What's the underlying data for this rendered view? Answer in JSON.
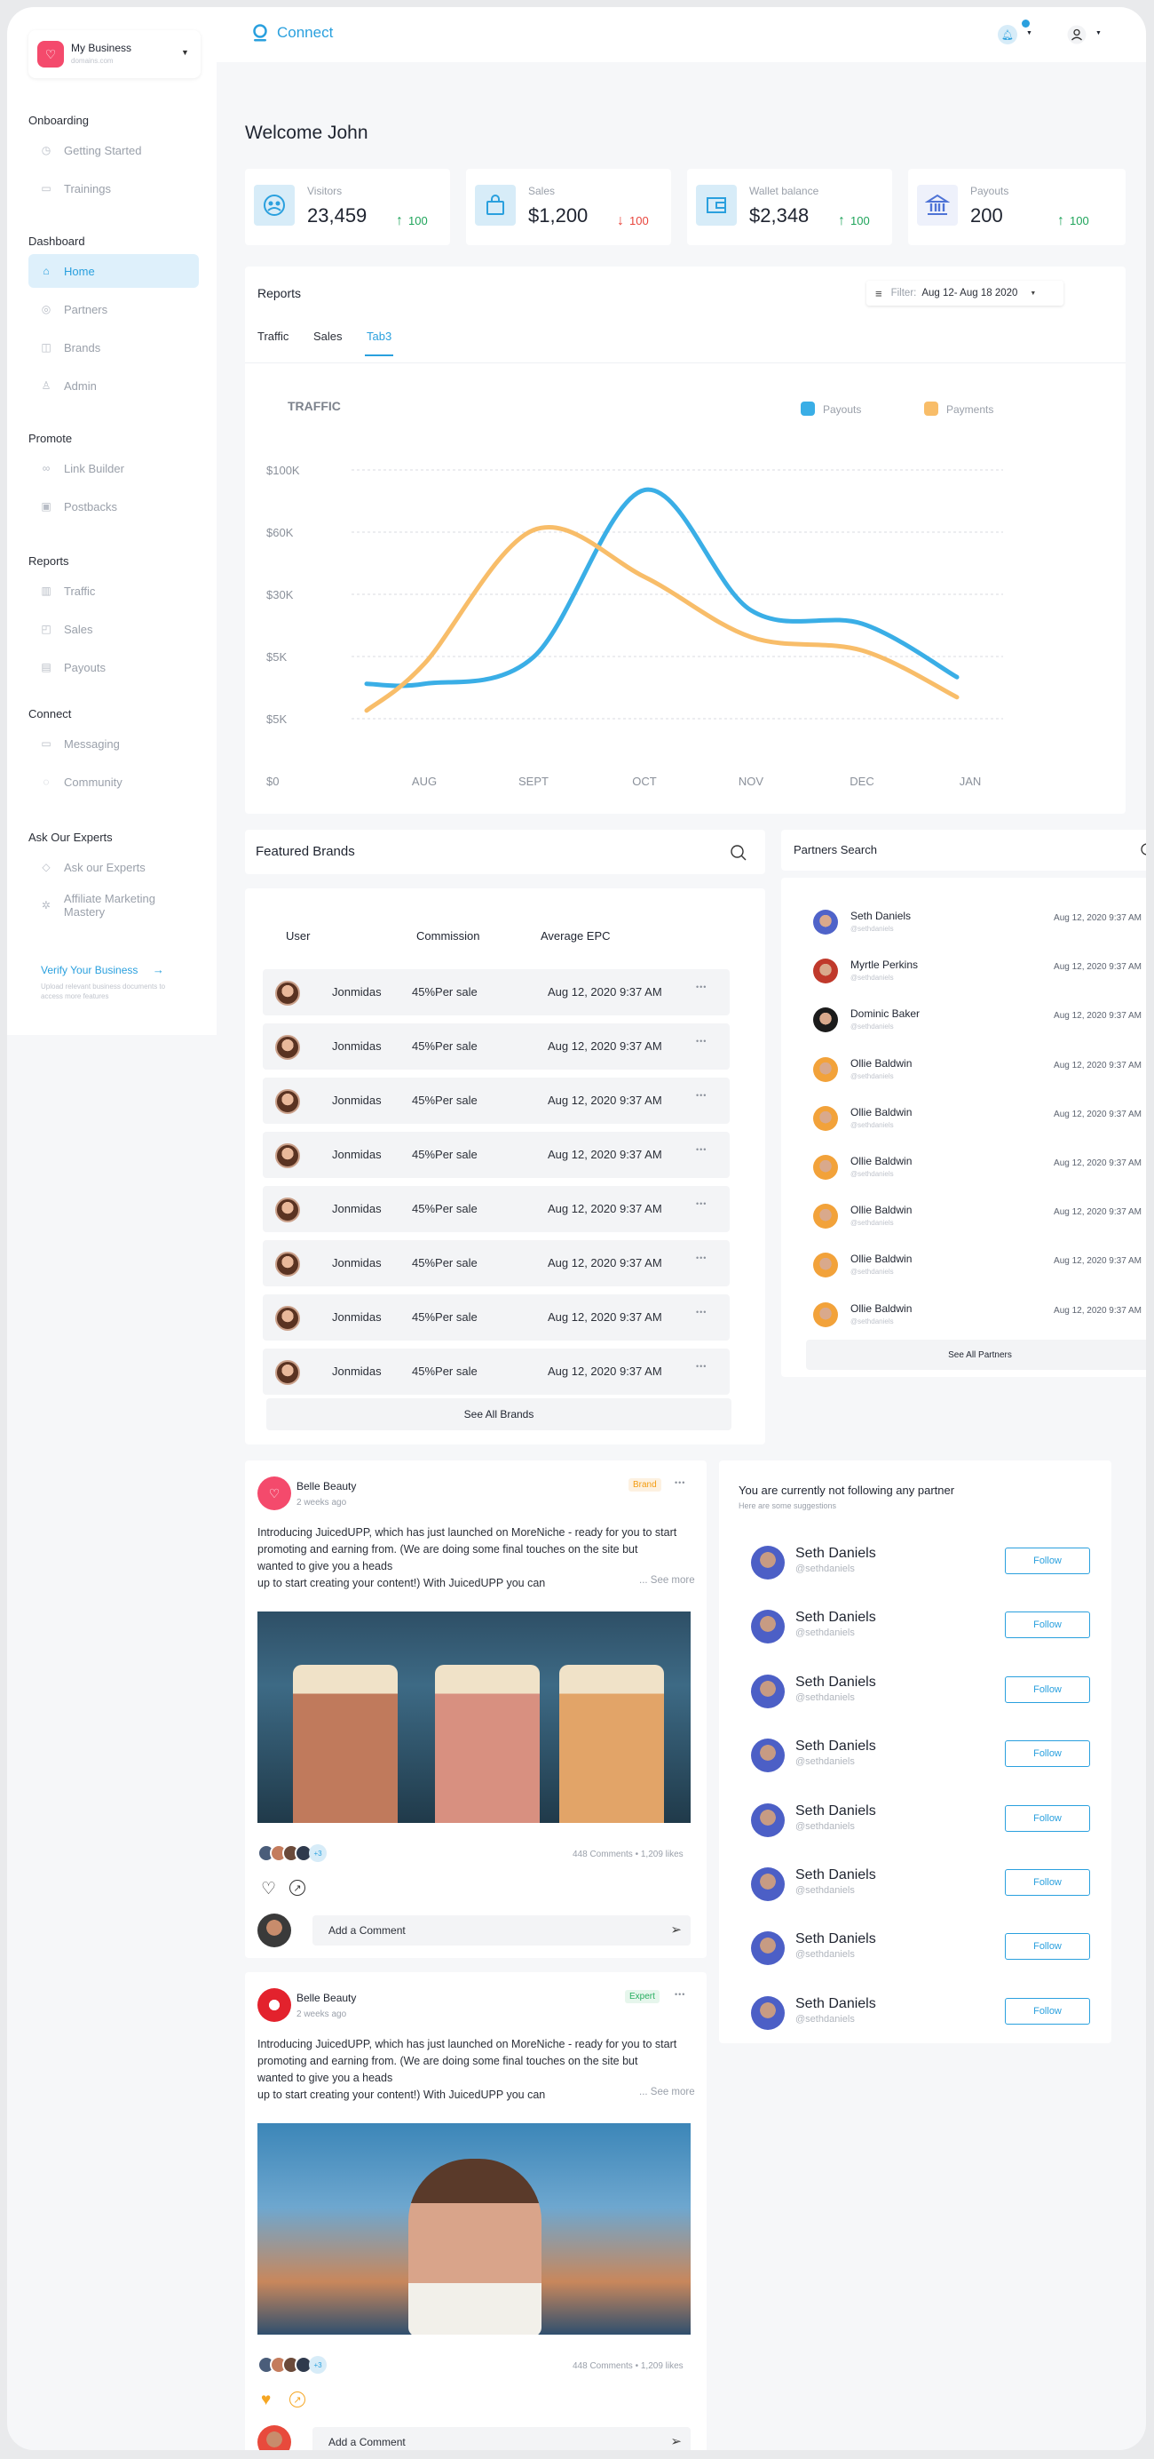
{
  "business": {
    "name": "My Business",
    "domain": "domains.com"
  },
  "header": {
    "app_name": "Connect"
  },
  "sidebar": {
    "sections": [
      {
        "title": "Onboarding",
        "items": [
          {
            "label": "Getting  Started",
            "icon": "clock-icon"
          },
          {
            "label": "Trainings",
            "icon": "book-icon"
          }
        ]
      },
      {
        "title": "Dashboard",
        "items": [
          {
            "label": "Home",
            "icon": "home-icon",
            "active": true
          },
          {
            "label": "Partners",
            "icon": "partners-icon"
          },
          {
            "label": "Brands",
            "icon": "brands-icon"
          },
          {
            "label": "Admin",
            "icon": "user-icon"
          }
        ]
      },
      {
        "title": "Promote",
        "items": [
          {
            "label": "Link Builder",
            "icon": "link-icon"
          },
          {
            "label": "Postbacks",
            "icon": "postbacks-icon"
          }
        ]
      },
      {
        "title": "Reports",
        "items": [
          {
            "label": "Traffic",
            "icon": "bar-chart-icon"
          },
          {
            "label": "Sales",
            "icon": "bag-icon"
          },
          {
            "label": "Payouts",
            "icon": "wallet-icon"
          }
        ]
      },
      {
        "title": "Connect",
        "items": [
          {
            "label": "Messaging",
            "icon": "message-icon"
          },
          {
            "label": "Community",
            "icon": "chat-icon"
          }
        ]
      },
      {
        "title": "Ask Our Experts",
        "items": [
          {
            "label": "Ask our Experts",
            "icon": "question-icon"
          },
          {
            "label": "Affiliate Marketing Mastery",
            "icon": "settings-icon"
          }
        ]
      }
    ],
    "verify": {
      "title": "Verify Your Business",
      "text": "Upload relevant business documents to access more features"
    }
  },
  "welcome": "Welcome John",
  "stats": [
    {
      "label": "Visitors",
      "value": "23,459",
      "delta": "100",
      "dir": "up"
    },
    {
      "label": "Sales",
      "value": "$1,200",
      "delta": "100",
      "dir": "down"
    },
    {
      "label": "Wallet balance",
      "value": "$2,348",
      "delta": "100",
      "dir": "up"
    },
    {
      "label": "Payouts",
      "value": "200",
      "delta": "100",
      "dir": "up"
    }
  ],
  "reports": {
    "title": "Reports",
    "filter_label": "Filter:",
    "filter_value": "Aug 12- Aug 18 2020",
    "tabs": [
      "Traffic",
      "Sales",
      "Tab3"
    ],
    "active_tab": 2
  },
  "chart_data": {
    "type": "line",
    "title": "TRAFFIC",
    "categories": [
      "AUG",
      "SEPT",
      "OCT",
      "NOV",
      "DEC",
      "JAN"
    ],
    "y_tick_labels": [
      "$100K",
      "$60K",
      "$30K",
      "$5K",
      "$5K",
      "$0"
    ],
    "grid": true,
    "legend_position": "top-right",
    "series": [
      {
        "name": "Payouts",
        "color": "#3aaee6",
        "values": [
          1.0,
          1.4,
          3.9,
          2.1,
          1.9,
          1.1
        ],
        "start": 1.0,
        "end": 1.1
      },
      {
        "name": "Payments",
        "color": "#f8bd69",
        "values": [
          1.3,
          3.3,
          2.6,
          1.7,
          1.5,
          0.8
        ],
        "start": 0.6,
        "end": 0.8
      }
    ]
  },
  "brands": {
    "title": "Featured Brands",
    "columns": [
      "User",
      "Commission",
      "Average EPC"
    ],
    "rows": [
      {
        "user": "Jonmidas",
        "commission": "45%Per sale",
        "epc": "Aug 12, 2020 9:37 AM"
      },
      {
        "user": "Jonmidas",
        "commission": "45%Per sale",
        "epc": "Aug 12, 2020 9:37 AM"
      },
      {
        "user": "Jonmidas",
        "commission": "45%Per sale",
        "epc": "Aug 12, 2020 9:37 AM"
      },
      {
        "user": "Jonmidas",
        "commission": "45%Per sale",
        "epc": "Aug 12, 2020 9:37 AM"
      },
      {
        "user": "Jonmidas",
        "commission": "45%Per sale",
        "epc": "Aug 12, 2020 9:37 AM"
      },
      {
        "user": "Jonmidas",
        "commission": "45%Per sale",
        "epc": "Aug 12, 2020 9:37 AM"
      },
      {
        "user": "Jonmidas",
        "commission": "45%Per sale",
        "epc": "Aug 12, 2020 9:37 AM"
      },
      {
        "user": "Jonmidas",
        "commission": "45%Per sale",
        "epc": "Aug 12, 2020 9:37 AM"
      }
    ],
    "see_all": "See All Brands"
  },
  "partners_search": {
    "title": "Partners Search",
    "rows": [
      {
        "name": "Seth Daniels",
        "handle": "@sethdaniels",
        "time": "Aug 12, 2020 9:37 AM",
        "color": "#4f63c9"
      },
      {
        "name": "Myrtle Perkins",
        "handle": "@sethdaniels",
        "time": "Aug 12, 2020 9:37 AM",
        "color": "#c0392b"
      },
      {
        "name": "Dominic Baker",
        "handle": "@sethdaniels",
        "time": "Aug 12, 2020 9:37 AM",
        "color": "#1b1b1b"
      },
      {
        "name": "Ollie Baldwin",
        "handle": "@sethdaniels",
        "time": "Aug 12, 2020 9:37 AM",
        "color": "#f2a23a"
      },
      {
        "name": "Ollie Baldwin",
        "handle": "@sethdaniels",
        "time": "Aug 12, 2020 9:37 AM",
        "color": "#f2a23a"
      },
      {
        "name": "Ollie Baldwin",
        "handle": "@sethdaniels",
        "time": "Aug 12, 2020 9:37 AM",
        "color": "#f2a23a"
      },
      {
        "name": "Ollie Baldwin",
        "handle": "@sethdaniels",
        "time": "Aug 12, 2020 9:37 AM",
        "color": "#f2a23a"
      },
      {
        "name": "Ollie Baldwin",
        "handle": "@sethdaniels",
        "time": "Aug 12, 2020 9:37 AM",
        "color": "#f2a23a"
      },
      {
        "name": "Ollie Baldwin",
        "handle": "@sethdaniels",
        "time": "Aug 12, 2020 9:37 AM",
        "color": "#f2a23a"
      }
    ],
    "see_all": "See All Partners"
  },
  "posts": [
    {
      "author": "Belle Beauty",
      "time": "2 weeks ago",
      "badge": "Brand",
      "badge_color": "#f39c12",
      "lines": [
        "Introducing JuicedUPP, which has just launched on MoreNiche - ready for you to start",
        "promoting and earning from. (We are doing some final touches on the site but",
        "wanted to give you a heads",
        "up to start creating your content!) With JuicedUPP you can"
      ],
      "see_more": "... See more",
      "extra_count": "+3",
      "stats": "448 Comments • 1,209 likes",
      "comment_placeholder": "Add a Comment"
    },
    {
      "author": "Belle Beauty",
      "time": "2 weeks ago",
      "badge": "Expert",
      "badge_color": "#27ae60",
      "lines": [
        "Introducing JuicedUPP, which has just launched on MoreNiche - ready for you to start",
        "promoting and earning from. (We are doing some final touches on the site but",
        "wanted to give you a heads",
        "up to start creating your content!) With JuicedUPP you can"
      ],
      "see_more": "... See more",
      "extra_count": "+3",
      "stats": "448 Comments • 1,209 likes",
      "comment_placeholder": "Add a Comment"
    }
  ],
  "suggestions": {
    "title": "You are currently not following any partner",
    "subtitle": "Here are some suggestions",
    "button": "Follow",
    "rows": [
      {
        "name": "Seth Daniels",
        "handle": "@sethdaniels"
      },
      {
        "name": "Seth Daniels",
        "handle": "@sethdaniels"
      },
      {
        "name": "Seth Daniels",
        "handle": "@sethdaniels"
      },
      {
        "name": "Seth Daniels",
        "handle": "@sethdaniels"
      },
      {
        "name": "Seth Daniels",
        "handle": "@sethdaniels"
      },
      {
        "name": "Seth Daniels",
        "handle": "@sethdaniels"
      },
      {
        "name": "Seth Daniels",
        "handle": "@sethdaniels"
      },
      {
        "name": "Seth Daniels",
        "handle": "@sethdaniels"
      }
    ]
  }
}
